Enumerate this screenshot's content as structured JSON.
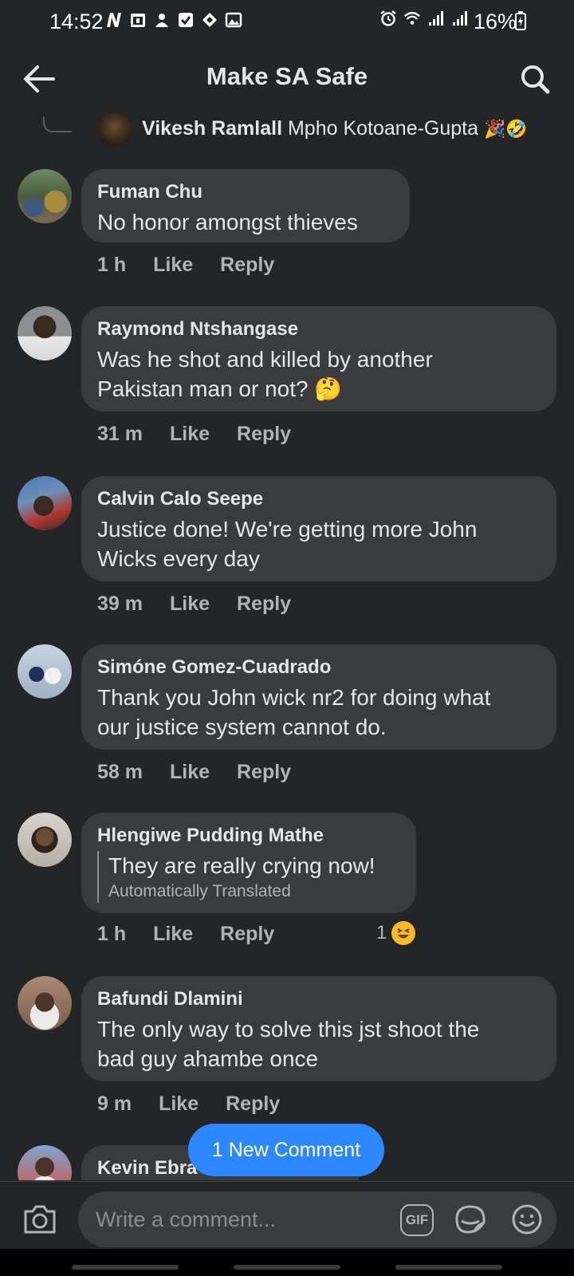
{
  "status_bar": {
    "time": "14:52",
    "battery": "16%",
    "left_icons": [
      "n-notification-icon",
      "calendar-icon",
      "app-notification-icon",
      "checkbox-icon",
      "diamond-icon",
      "gallery-icon"
    ],
    "right_icons": [
      "alarm-icon",
      "wifi-icon",
      "signal-icon",
      "signal-icon",
      "battery-charging-icon"
    ]
  },
  "header": {
    "title": "Make SA Safe",
    "back_icon": "arrow-left-icon",
    "search_icon": "search-icon"
  },
  "partial_reply": {
    "name": "Vikesh Ramlall",
    "tag": "Mpho Kotoane-Gupta",
    "emojis": "🎉🤣"
  },
  "comments": [
    {
      "name": "Fuman Chu",
      "text": "No honor  amongst thieves",
      "time": "1 h",
      "like": "Like",
      "reply": "Reply"
    },
    {
      "name": "Raymond Ntshangase",
      "line1": "Was he shot and killed by another",
      "line2": "Pakistan man or not?",
      "emoji": "🤔",
      "time": "31 m",
      "like": "Like",
      "reply": "Reply"
    },
    {
      "name": "Calvin Calo Seepe",
      "line1": "Justice done! We're getting more John",
      "line2": "Wicks every day",
      "time": "39 m",
      "like": "Like",
      "reply": "Reply"
    },
    {
      "name": "Simóne Gomez-Cuadrado",
      "line1": "Thank you John wick nr2 for doing what",
      "line2": "our justice system cannot do.",
      "time": "58 m",
      "like": "Like",
      "reply": "Reply"
    },
    {
      "name": "Hlengiwe Pudding Mathe",
      "text": "They are really crying now!",
      "note": "Automatically Translated",
      "time": "1 h",
      "like": "Like",
      "reply": "Reply",
      "reaction_count": "1",
      "reaction_emoji": "laughing-emoji"
    },
    {
      "name": "Bafundi Dlamini",
      "line1": "The only way to solve this jst shoot the",
      "line2": "bad guy ahambe once",
      "time": "9 m",
      "like": "Like",
      "reply": "Reply"
    },
    {
      "name": "Kevin Ebra"
    }
  ],
  "new_comment_pill": "1 New Comment",
  "composer": {
    "placeholder": "Write a comment...",
    "gif_label": "GIF",
    "camera_icon": "camera-icon",
    "sticker_icon": "sticker-icon",
    "emoji_icon": "smiley-icon"
  }
}
